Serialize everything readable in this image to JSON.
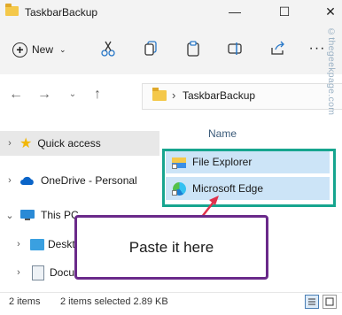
{
  "window": {
    "title": "TaskbarBackup"
  },
  "toolbar": {
    "new_label": "New"
  },
  "address": {
    "crumb": "TaskbarBackup"
  },
  "nav": {
    "items": [
      {
        "label": "Quick access",
        "icon": "star-icon"
      },
      {
        "label": "OneDrive - Personal",
        "icon": "cloud-icon"
      },
      {
        "label": "This PC",
        "icon": "monitor-icon"
      },
      {
        "label": "Deskt",
        "icon": "desktop-icon"
      },
      {
        "label": "Docu",
        "icon": "document-icon"
      }
    ]
  },
  "content": {
    "column_header": "Name",
    "files": [
      {
        "name": "File Explorer",
        "icon": "file-explorer-shortcut-icon"
      },
      {
        "name": "Microsoft Edge",
        "icon": "edge-shortcut-icon"
      }
    ]
  },
  "annotation": {
    "callout_text": "Paste it here",
    "box_color": "#17a58f",
    "callout_color": "#6a2a8a",
    "arrow_color": "#e0314b"
  },
  "status": {
    "items": "2 items",
    "selected": "2 items selected  2.89 KB"
  },
  "watermark": "©thegeekpage.com"
}
